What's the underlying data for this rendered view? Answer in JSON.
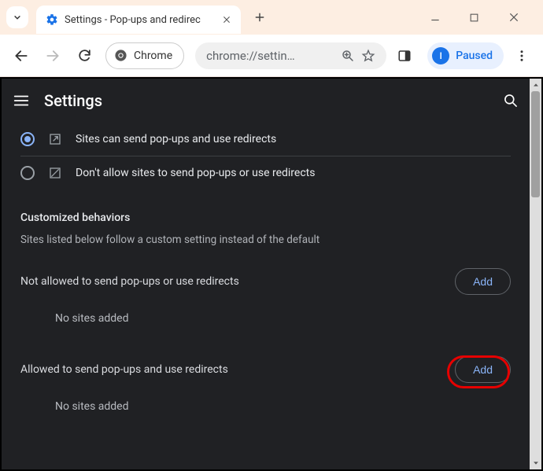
{
  "window": {
    "tab_title": "Settings - Pop-ups and redirec"
  },
  "toolbar": {
    "chrome_chip": "Chrome",
    "omnibox_url": "chrome://settin…",
    "profile_status": "Paused",
    "profile_initial": "I"
  },
  "app": {
    "title": "Settings"
  },
  "radios": {
    "allow": "Sites can send pop-ups and use redirects",
    "block": "Don't allow sites to send pop-ups or use redirects"
  },
  "sections": {
    "custom_header": "Customized behaviors",
    "custom_sub": "Sites listed below follow a custom setting instead of the default",
    "not_allowed_title": "Not allowed to send pop-ups or use redirects",
    "allowed_title": "Allowed to send pop-ups and use redirects",
    "add_label": "Add",
    "empty": "No sites added"
  }
}
